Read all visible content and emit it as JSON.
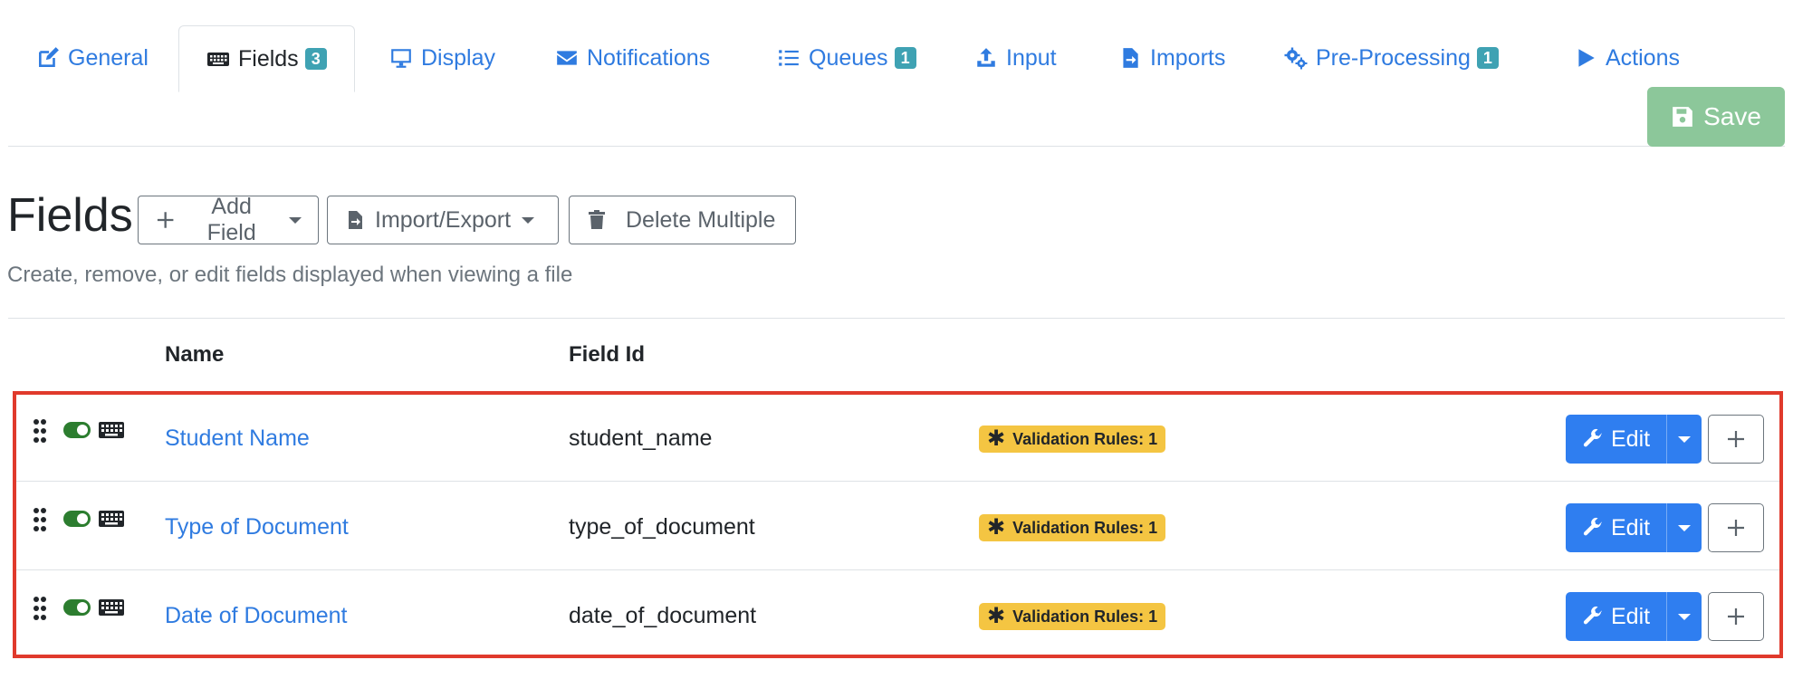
{
  "tabs": [
    {
      "label": "General",
      "icon": "edit-icon",
      "badge": ""
    },
    {
      "label": "Fields",
      "icon": "keyboard-icon",
      "badge": "3"
    },
    {
      "label": "Display",
      "icon": "monitor-icon",
      "badge": ""
    },
    {
      "label": "Notifications",
      "icon": "envelope-icon",
      "badge": ""
    },
    {
      "label": "Queues",
      "icon": "list-icon",
      "badge": "1"
    },
    {
      "label": "Input",
      "icon": "upload-icon",
      "badge": ""
    },
    {
      "label": "Imports",
      "icon": "file-import-icon",
      "badge": ""
    },
    {
      "label": "Pre-Processing",
      "icon": "gears-icon",
      "badge": "1"
    },
    {
      "label": "Actions",
      "icon": "play-icon",
      "badge": ""
    }
  ],
  "toolbar": {
    "save_label": "Save"
  },
  "header": {
    "title": "Fields",
    "add_field_label": "Add Field",
    "import_export_label": "Import/Export",
    "delete_multiple_label": "Delete Multiple",
    "subtitle": "Create, remove, or edit fields displayed when viewing a file"
  },
  "table": {
    "columns": [
      "Name",
      "Field Id"
    ],
    "rows": [
      {
        "name": "Student Name",
        "field_id": "student_name",
        "validation": "Validation Rules: 1",
        "edit_label": "Edit"
      },
      {
        "name": "Type of Document",
        "field_id": "type_of_document",
        "validation": "Validation Rules: 1",
        "edit_label": "Edit"
      },
      {
        "name": "Date of Document",
        "field_id": "date_of_document",
        "validation": "Validation Rules: 1",
        "edit_label": "Edit"
      }
    ]
  },
  "colors": {
    "link": "#2f7be0",
    "badge_info": "#3fa2b3",
    "save_disabled": "#8cc79a",
    "validation_badge": "#f4c542",
    "edit_button": "#2f7ef0",
    "toggle_on": "#2c7d2f",
    "highlight_border": "#e03a2c"
  }
}
